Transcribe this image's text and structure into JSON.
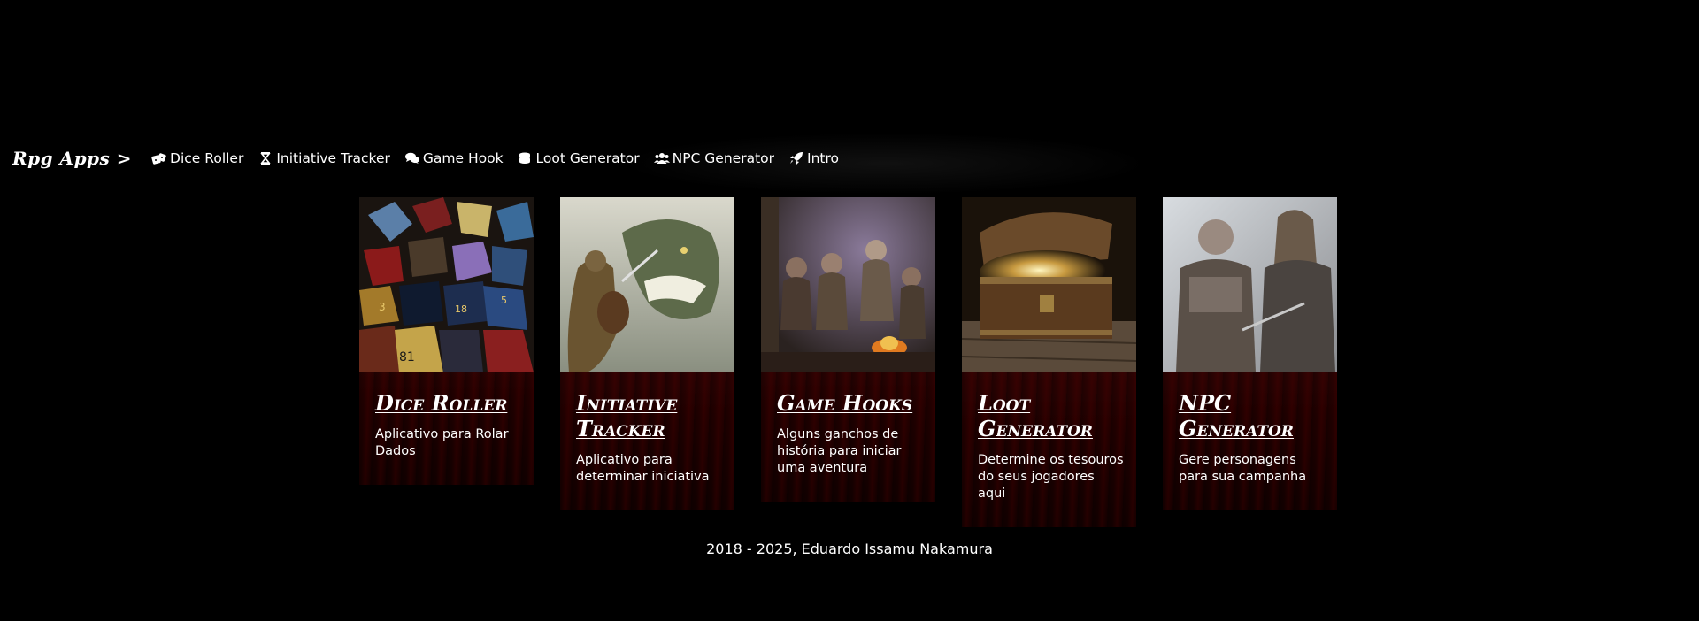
{
  "nav": {
    "brand": "Rpg Apps >",
    "items": [
      {
        "label": "Dice Roller",
        "icon": "dice-icon"
      },
      {
        "label": "Initiative Tracker",
        "icon": "hourglass-icon"
      },
      {
        "label": "Game Hook",
        "icon": "comments-icon"
      },
      {
        "label": "Loot Generator",
        "icon": "coins-icon"
      },
      {
        "label": "NPC Generator",
        "icon": "users-icon"
      },
      {
        "label": "Intro",
        "icon": "rocket-icon"
      }
    ]
  },
  "cards": [
    {
      "title": "Dice Roller",
      "description": "Aplicativo para Rolar Dados",
      "image": "dice-image"
    },
    {
      "title": "Initiative Tracker",
      "description": "Aplicativo para determinar iniciativa",
      "image": "knight-dragon-image"
    },
    {
      "title": "Game Hooks",
      "description": "Alguns ganchos de história para iniciar uma aventura",
      "image": "tavern-group-image"
    },
    {
      "title": "Loot Generator",
      "description": "Determine os tesouros do seus jogadores aqui",
      "image": "treasure-chest-image"
    },
    {
      "title": "NPC Generator",
      "description": "Gere personagens para sua campanha",
      "image": "warriors-image"
    }
  ],
  "footer": {
    "text": "2018 - 2025, Eduardo Issamu Nakamura"
  },
  "colors": {
    "background": "#000000",
    "card_bg": "#2a0000",
    "text": "#ffffff"
  }
}
